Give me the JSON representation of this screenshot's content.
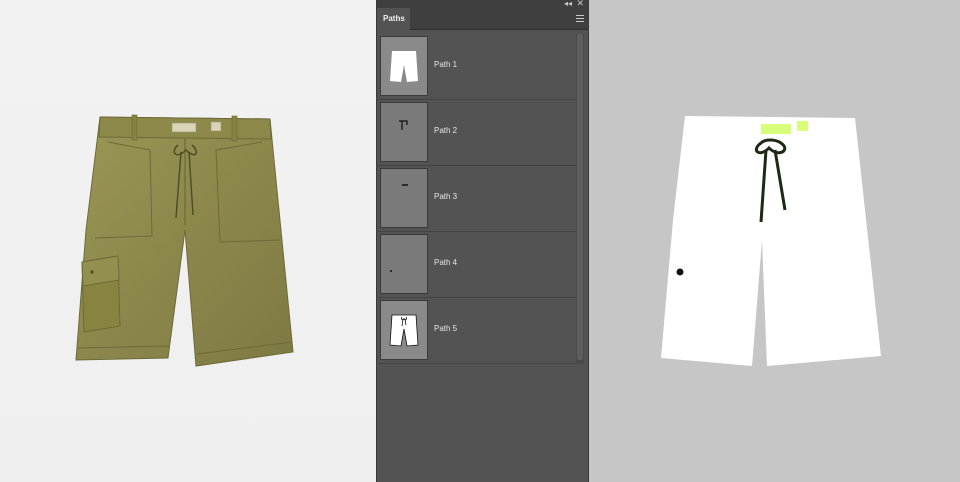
{
  "panel": {
    "tab_label": "Paths",
    "collapse_glyph": "◂◂",
    "close_glyph": "✕",
    "menu_icon": "hamburger-menu-icon"
  },
  "paths": [
    {
      "label": "Path 1",
      "thumb": "full-shorts-silhouette"
    },
    {
      "label": "Path 2",
      "thumb": "label-mark"
    },
    {
      "label": "Path 3",
      "thumb": "small-mark"
    },
    {
      "label": "Path 4",
      "thumb": "dot"
    },
    {
      "label": "Path 5",
      "thumb": "shorts-with-drawstring"
    }
  ],
  "colors": {
    "shorts_olive": "#8e8a4e",
    "mask_white": "#ffffff",
    "drawstring": "#1c2a14",
    "label_highlight": "#d8ff7a",
    "panel_bg": "#535353",
    "right_canvas_bg": "#c6c6c6"
  }
}
